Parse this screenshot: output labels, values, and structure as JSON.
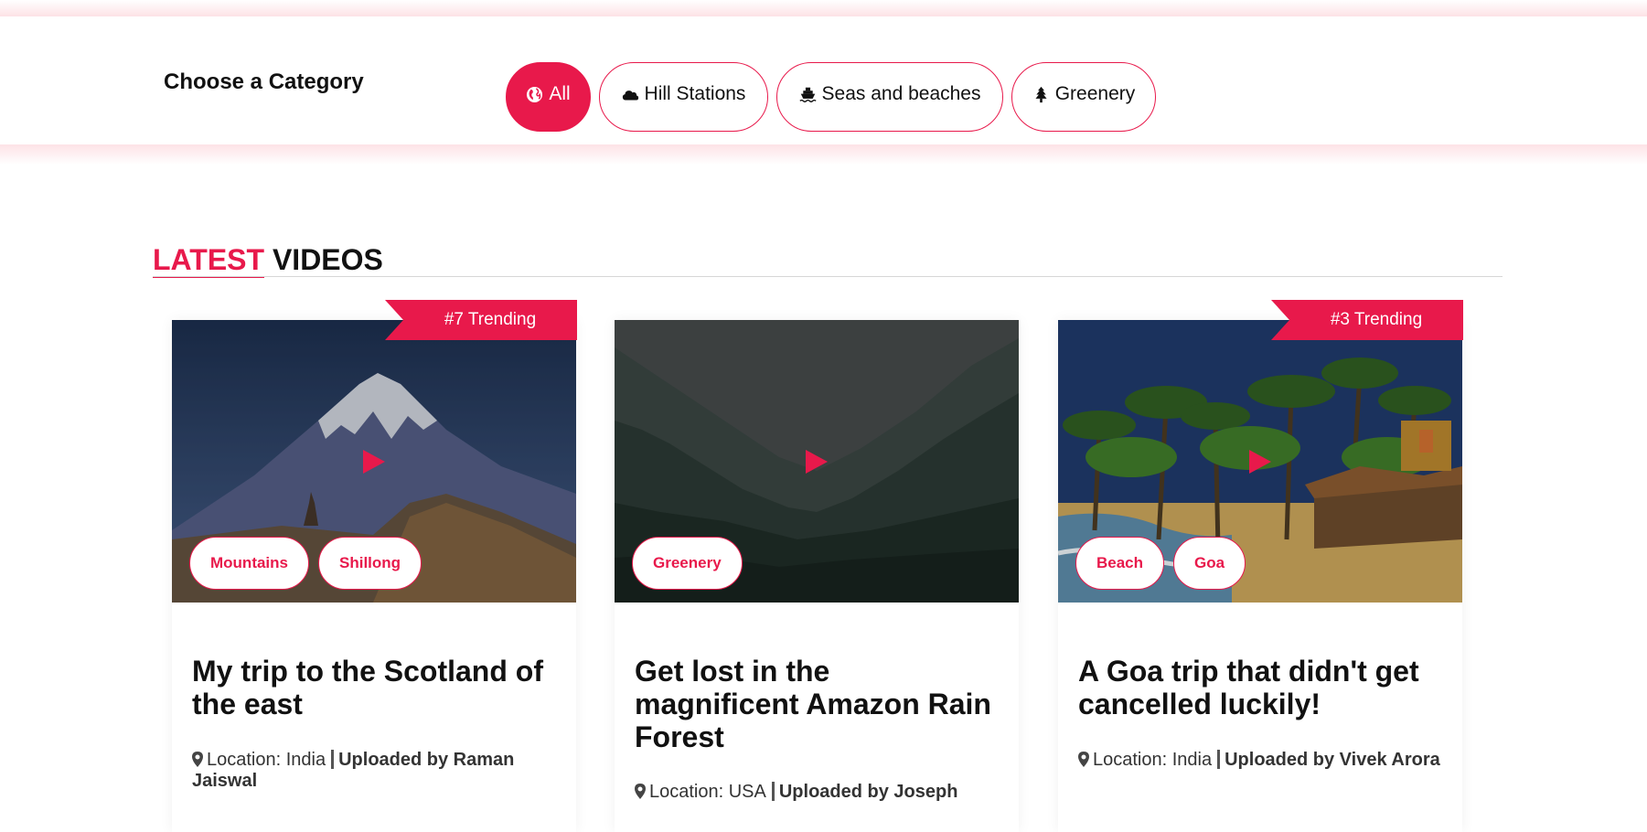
{
  "category_bar": {
    "label": "Choose a Category",
    "buttons": [
      {
        "label": "All",
        "icon": "globe-icon",
        "active": true
      },
      {
        "label": "Hill Stations",
        "icon": "cloud-icon",
        "active": false
      },
      {
        "label": "Seas and beaches",
        "icon": "ship-icon",
        "active": false
      },
      {
        "label": "Greenery",
        "icon": "tree-icon",
        "active": false
      }
    ]
  },
  "section": {
    "title_accent": "LATEST",
    "title_rest": "VIDEOS"
  },
  "videos": [
    {
      "ribbon": "#7 Trending",
      "thumbnail": "snowy-mountain-image",
      "tags": [
        "Mountains",
        "Shillong"
      ],
      "title": "My trip to the Scotland of the east",
      "location": "Location: India",
      "uploader": "Uploaded by Raman Jaiswal"
    },
    {
      "ribbon": "",
      "thumbnail": "misty-forest-image",
      "tags": [
        "Greenery"
      ],
      "title": "Get lost in the magnificent Amazon Rain Forest",
      "location": "Location: USA",
      "uploader": "Uploaded by Joseph"
    },
    {
      "ribbon": "#3 Trending",
      "thumbnail": "goa-beach-image",
      "tags": [
        "Beach",
        "Goa"
      ],
      "title": "A Goa trip that didn't get cancelled luckily!",
      "location": "Location: India",
      "uploader": "Uploaded by Vivek Arora"
    }
  ],
  "colors": {
    "accent": "#e8194b",
    "text": "#111111",
    "page_bg": "#ffffff"
  }
}
